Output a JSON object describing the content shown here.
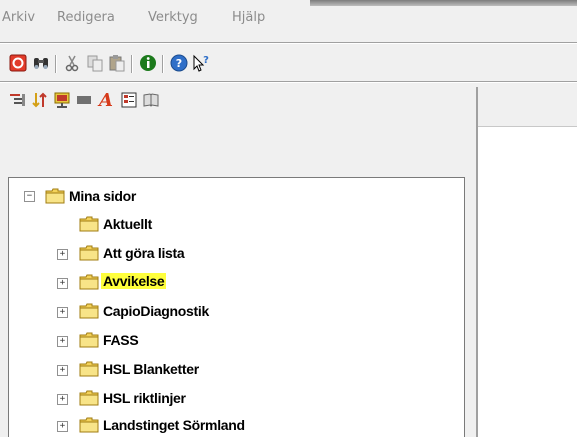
{
  "menu": {
    "items": [
      "Arkiv",
      "Redigera",
      "Verktyg",
      "Hjälp"
    ]
  },
  "toolbar": {
    "icons": [
      "stop-icon",
      "find-icon",
      "cut-icon",
      "copy-icon",
      "paste-icon",
      "info-icon",
      "help-icon",
      "whats-this-icon"
    ]
  },
  "toolbar2": {
    "icons": [
      "menu-list-icon",
      "sort-icon",
      "presentation-icon",
      "block-icon",
      "font-icon",
      "checklist-icon",
      "book-icon"
    ]
  },
  "tree": {
    "root": "Mina sidor",
    "items": [
      {
        "label": "Aktuellt",
        "expandable": false,
        "highlighted": false
      },
      {
        "label": "Att göra lista",
        "expandable": true,
        "highlighted": false
      },
      {
        "label": "Avvikelse",
        "expandable": true,
        "highlighted": true
      },
      {
        "label": "CapioDiagnostik",
        "expandable": true,
        "highlighted": false
      },
      {
        "label": "FASS",
        "expandable": true,
        "highlighted": false
      },
      {
        "label": "HSL Blanketter",
        "expandable": true,
        "highlighted": false
      },
      {
        "label": "HSL riktlinjer",
        "expandable": true,
        "highlighted": false
      },
      {
        "label": "Landstinget Sörmland",
        "expandable": true,
        "highlighted": false
      }
    ]
  },
  "colors": {
    "highlight": "#ffff3c",
    "folder": "#f3d25a"
  }
}
